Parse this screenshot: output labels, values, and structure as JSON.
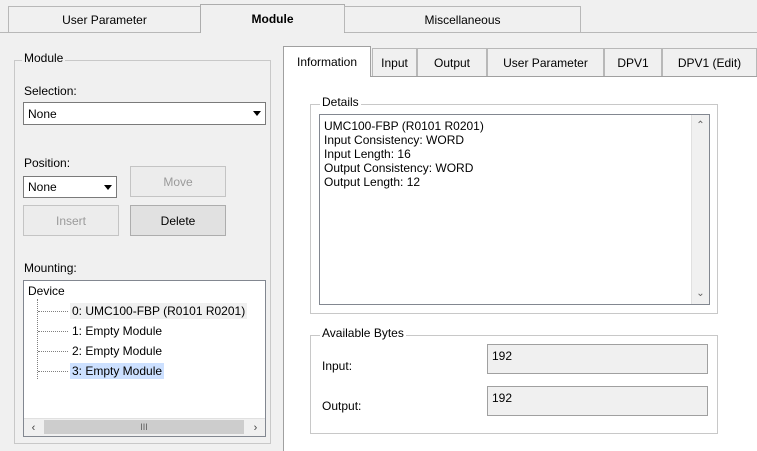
{
  "top_tabs": [
    "User Parameter",
    "Module",
    "Miscellaneous"
  ],
  "left": {
    "group_title": "Module",
    "selection_label": "Selection:",
    "selection_value": "None",
    "position_label": "Position:",
    "position_value": "None",
    "move_label": "Move",
    "insert_label": "Insert",
    "delete_label": "Delete",
    "mounting_label": "Mounting:",
    "tree": {
      "root": "Device",
      "items": [
        "0: UMC100-FBP (R0101 R0201)",
        "1: Empty Module",
        "2: Empty Module",
        "3: Empty Module"
      ],
      "selected_index": 3
    },
    "hscroll_thumb": "III"
  },
  "inner_tabs": [
    "Information",
    "Input",
    "Output",
    "User Parameter",
    "DPV1",
    "DPV1 (Edit)"
  ],
  "details": {
    "title": "Details",
    "lines": [
      "UMC100-FBP (R0101 R0201)",
      "Input Consistency: WORD",
      "Input Length: 16",
      "Output Consistency: WORD",
      "Output Length: 12"
    ]
  },
  "bytes": {
    "title": "Available Bytes",
    "input_label": "Input:",
    "input_value": "192",
    "output_label": "Output:",
    "output_value": "192"
  },
  "colors": {
    "selection_highlight": "#cce0ff"
  }
}
